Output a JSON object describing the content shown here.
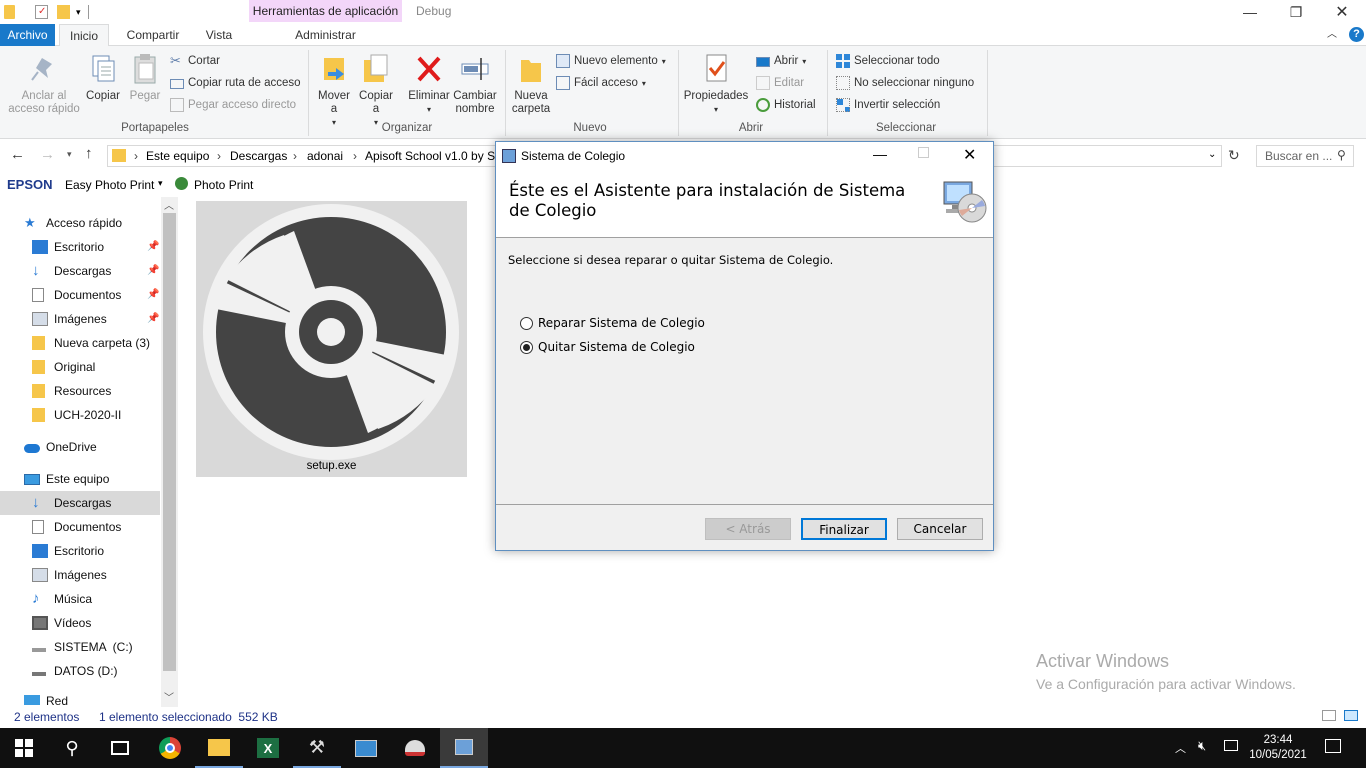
{
  "titlebar": {
    "context_tab": "Herramientas de aplicación",
    "window_title": "Debug"
  },
  "tabs": [
    "Archivo",
    "Inicio",
    "Compartir",
    "Vista",
    "Administrar"
  ],
  "ribbon": {
    "portapapeles": {
      "anclar": "Anclar al acceso rápido",
      "copiar": "Copiar",
      "pegar": "Pegar",
      "cortar": "Cortar",
      "copiar_ruta": "Copiar ruta de acceso",
      "pegar_acceso": "Pegar acceso directo",
      "label": "Portapapeles"
    },
    "organizar": {
      "mover": "Mover a",
      "copiar": "Copiar a",
      "eliminar": "Eliminar",
      "cambiar": "Cambiar nombre",
      "label": "Organizar"
    },
    "nuevo": {
      "nueva_carpeta": "Nueva carpeta",
      "nuevo_elemento": "Nuevo elemento",
      "facil_acceso": "Fácil acceso",
      "label": "Nuevo"
    },
    "abrir": {
      "propiedades": "Propiedades",
      "abrir": "Abrir",
      "editar": "Editar",
      "historial": "Historial",
      "label": "Abrir"
    },
    "seleccionar": {
      "todo": "Seleccionar todo",
      "ninguno": "No seleccionar ninguno",
      "invertir": "Invertir selección",
      "label": "Seleccionar"
    }
  },
  "address": {
    "crumbs": [
      "Este equipo",
      "Descargas",
      "adonai",
      "Apisoft School v1.0 by St"
    ],
    "search_placeholder": "Buscar en ..."
  },
  "epson": {
    "brand": "EPSON",
    "easy_photo": "Easy Photo Print",
    "photo_print": "Photo Print"
  },
  "navpane": {
    "quick_access": "Acceso rápido",
    "quick_items": [
      "Escritorio",
      "Descargas",
      "Documentos",
      "Imágenes",
      "Nueva carpeta (3)",
      "Original",
      "Resources",
      "UCH-2020-II"
    ],
    "onedrive": "OneDrive",
    "this_pc": "Este equipo",
    "pc_items": [
      "Descargas",
      "Documentos",
      "Escritorio",
      "Imágenes",
      "Música",
      "Vídeos",
      "SISTEMA  (C:)",
      "DATOS (D:)"
    ],
    "red": "Red"
  },
  "file": {
    "name": "setup.exe"
  },
  "status": {
    "count": "2 elementos",
    "selected": "1 elemento seleccionado  552 KB"
  },
  "dialog": {
    "title": "Sistema de Colegio",
    "heading": "Éste es el Asistente para instalación de Sistema de Colegio",
    "prompt": "Seleccione si desea reparar o quitar Sistema de Colegio.",
    "options": [
      "Reparar Sistema de Colegio",
      "Quitar Sistema de Colegio"
    ],
    "selected_option": "Quitar Sistema de Colegio",
    "back": "< Atrás",
    "finish": "Finalizar",
    "cancel": "Cancelar"
  },
  "watermark": {
    "title": "Activar Windows",
    "subtitle": "Ve a Configuración para activar Windows."
  },
  "clock": {
    "time": "23:44",
    "date": "10/05/2021"
  },
  "colors": {
    "accent": "#1979ca",
    "context_tab": "#f3d6f9",
    "selection": "#cce8ff"
  }
}
